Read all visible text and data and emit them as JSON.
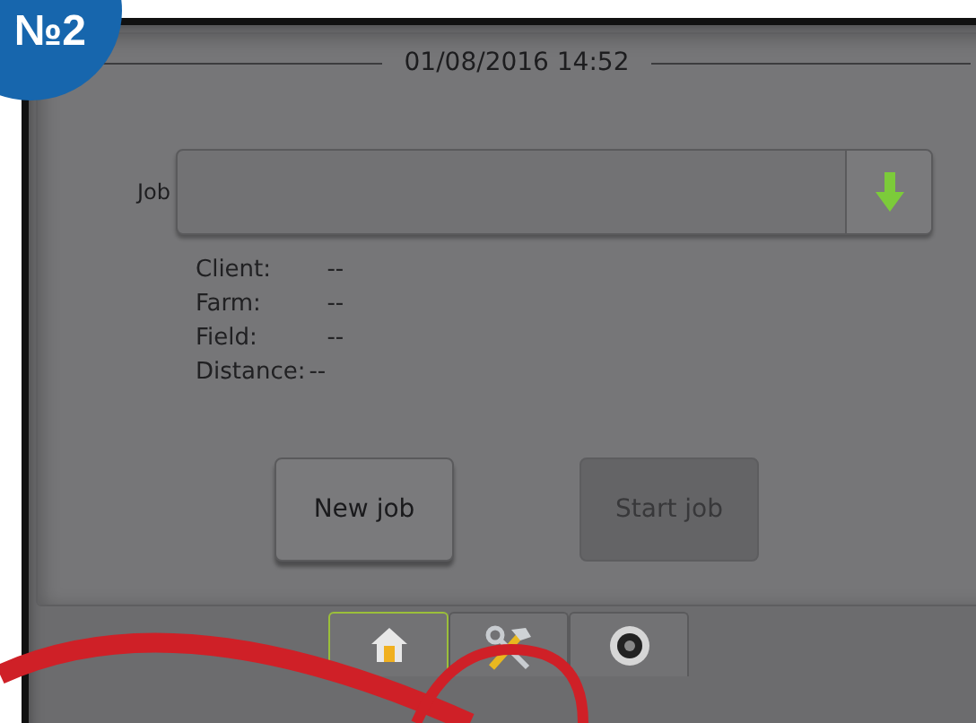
{
  "badge": "№2",
  "header": {
    "datetime": "01/08/2016 14:52"
  },
  "job": {
    "label": "Job"
  },
  "details": [
    {
      "label": "Client:",
      "value": "--"
    },
    {
      "label": "Farm:",
      "value": "--"
    },
    {
      "label": "Field:",
      "value": "--"
    },
    {
      "label": "Distance:",
      "value": "--"
    }
  ],
  "buttons": [
    {
      "label": "New job",
      "disabled": false
    },
    {
      "label": "Start job",
      "disabled": true
    }
  ],
  "tabs": [
    {
      "kind": "home",
      "selected": true
    },
    {
      "kind": "tools",
      "selected": false
    },
    {
      "kind": "camera",
      "selected": false
    }
  ]
}
